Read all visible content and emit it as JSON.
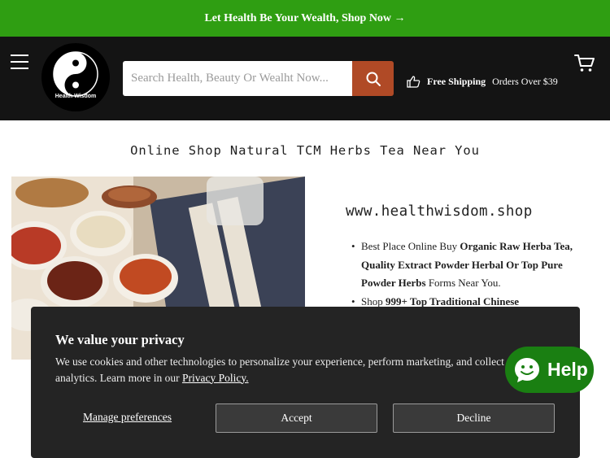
{
  "announcement": {
    "text": "Let Health Be Your Wealth, Shop Now →"
  },
  "header": {
    "logo_text": "Health Wisdom",
    "search_placeholder": "Search Health, Beauty Or Wealht Now...",
    "shipping_bold": "Free Shipping",
    "shipping_rest": "Orders Over $39",
    "icons": {
      "menu": "hamburger-menu-icon",
      "search": "search-icon",
      "shipping": "thumbs-up-icon",
      "cart": "cart-icon"
    }
  },
  "main": {
    "tagline": "Online Shop Natural TCM Herbs Tea Near You",
    "site_url": "www.healthwisdom.shop",
    "bullets": [
      {
        "a": "Best Place Online Buy ",
        "b": "Organic Raw Herba Tea, Quality Extract Powder Herbal Or Top Pure Powder Herbs",
        "c": " Forms Near You."
      },
      {
        "a": "Shop ",
        "b": "999+ Top Traditional Chinese",
        "c": ""
      }
    ]
  },
  "help_button": {
    "label": "Help",
    "icon": "chat-bubble-icon"
  },
  "cookie_banner": {
    "title": "We value your privacy",
    "body": "We use cookies and other technologies to personalize your experience, perform marketing, and collect analytics. Learn more in our ",
    "link": "Privacy Policy.",
    "manage": "Manage preferences",
    "accept": "Accept",
    "decline": "Decline"
  },
  "colors": {
    "announcement_bg": "#2f9e12",
    "header_bg": "#141414",
    "search_button": "#b04a26",
    "help_button": "#1a7f12",
    "cookie_bg": "#242424"
  }
}
